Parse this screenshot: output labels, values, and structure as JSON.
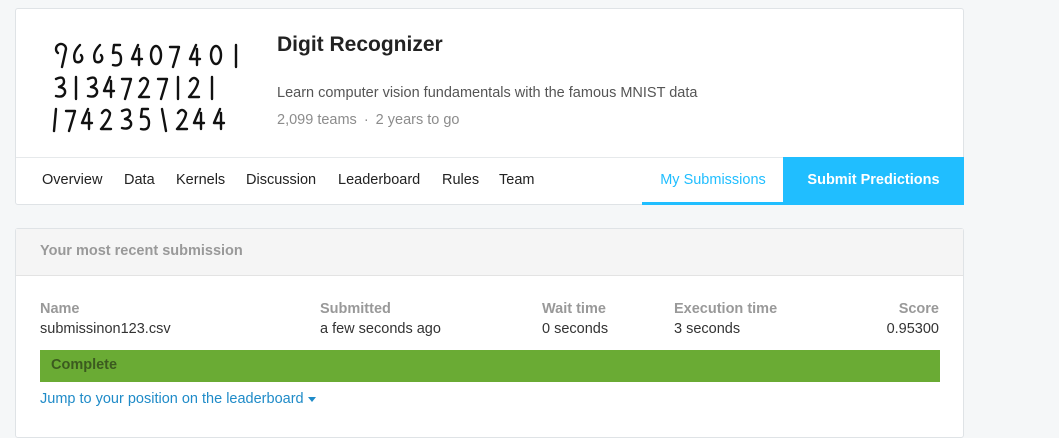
{
  "competition": {
    "title": "Digit Recognizer",
    "description": "Learn computer vision fundamentals with the famous MNIST data",
    "teams": "2,099 teams",
    "separator": "·",
    "deadline": "2 years to go"
  },
  "tabs": {
    "items": [
      "Overview",
      "Data",
      "Kernels",
      "Discussion",
      "Leaderboard",
      "Rules",
      "Team"
    ],
    "my_submissions": "My Submissions",
    "submit_predictions": "Submit Predictions"
  },
  "submission": {
    "heading": "Your most recent submission",
    "name_label": "Name",
    "name_value": "submissinon123.csv",
    "submitted_label": "Submitted",
    "submitted_value": "a few seconds ago",
    "wait_label": "Wait time",
    "wait_value": "0 seconds",
    "exec_label": "Execution time",
    "exec_value": "3 seconds",
    "score_label": "Score",
    "score_value": "0.95300",
    "status": "Complete",
    "jump_link": "Jump to your position on the leaderboard"
  },
  "colors": {
    "accent": "#20beff",
    "complete": "#6aab34",
    "link": "#1f8bc8"
  },
  "icons": {
    "thumbnail": "mnist-digits-image",
    "jump_caret": "caret-down-icon"
  }
}
